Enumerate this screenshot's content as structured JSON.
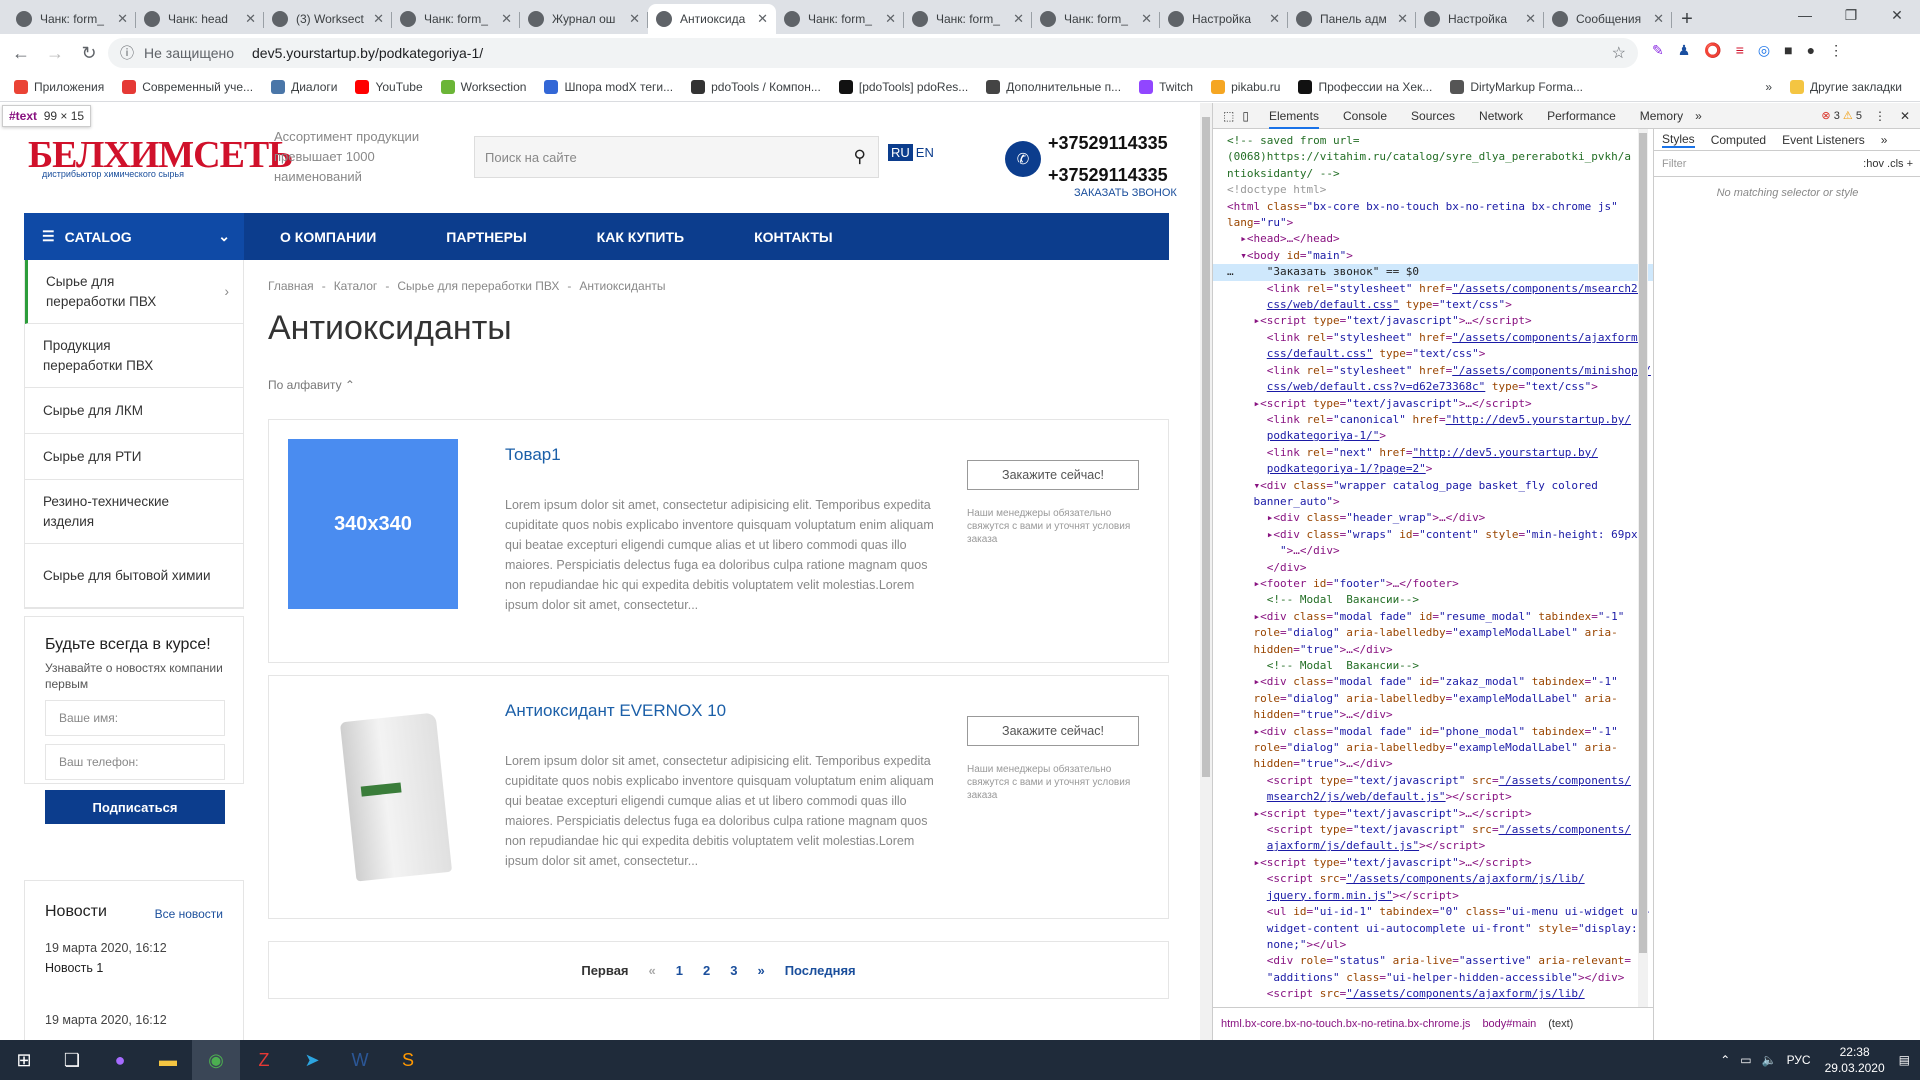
{
  "browser": {
    "tabs": [
      {
        "title": "Чанк: form_",
        "active": false
      },
      {
        "title": "Чанк: head",
        "active": false
      },
      {
        "title": "(3) Worksect",
        "active": false
      },
      {
        "title": "Чанк: form_",
        "active": false
      },
      {
        "title": "Журнал ош",
        "active": false
      },
      {
        "title": "Антиоксида",
        "active": true
      },
      {
        "title": "Чанк: form_",
        "active": false
      },
      {
        "title": "Чанк: form_",
        "active": false
      },
      {
        "title": "Чанк: form_",
        "active": false
      },
      {
        "title": "Настройка",
        "active": false
      },
      {
        "title": "Панель адм",
        "active": false
      },
      {
        "title": "Настройка",
        "active": false
      },
      {
        "title": "Сообщения",
        "active": false
      }
    ],
    "security": "Не защищено",
    "url": "dev5.yourstartup.by/podkategoriya-1/",
    "bookmarks": [
      "Приложения",
      "Современный уче...",
      "Диалоги",
      "YouTube",
      "Worksection",
      "Шпора modX теги...",
      "pdoTools / Компон...",
      "[pdoTools] pdoRes...",
      "Дополнительные п...",
      "Twitch",
      "pikabu.ru",
      "Профессии на Хек...",
      "DirtyMarkup Forma..."
    ],
    "other_bookmarks": "Другие закладки"
  },
  "site": {
    "tooltip_name": "#text",
    "tooltip_size": "99 × 15",
    "logo": "БЕЛХИМСЕТЬ",
    "logo_sub": "дистрибьютор химического сырья",
    "tagline": "Ассортимент продукции превышает 1000 наименований",
    "search_placeholder": "Поиск на сайте",
    "lang_ru": "RU",
    "lang_en": "EN",
    "phone1": "+37529114335",
    "phone2": "+37529114335",
    "callback": "ЗАКАЗАТЬ ЗВОНОК",
    "catalog": "CATALOG",
    "nav": [
      "О КОМПАНИИ",
      "ПАРТНЕРЫ",
      "КАК КУПИТЬ",
      "КОНТАКТЫ"
    ],
    "sidebar": [
      "Сырье для переработки ПВХ",
      "Продукция переработки ПВХ",
      "Сырье для ЛКМ",
      "Сырье для РТИ",
      "Резино-технические изделия",
      "Сырье для бытовой химии"
    ],
    "subscribe": {
      "title": "Будьте всегда в курсе!",
      "text": "Узнавайте о новостях компании первым",
      "name_ph": "Ваше имя:",
      "phone_ph": "Ваш телефон:",
      "button": "Подписаться"
    },
    "news": {
      "title": "Новости",
      "all": "Все новости",
      "item1_date": "19 марта 2020, 16:12",
      "item1_title": "Новость 1",
      "item2_date": "19 марта 2020, 16:12"
    },
    "breadcrumb": [
      "Главная",
      "Каталог",
      "Сырье для переработки ПВХ",
      "Антиоксиданты"
    ],
    "h1": "Антиоксиданты",
    "sort": "По алфавиту ⌃",
    "products": [
      {
        "name": "Товар1",
        "image_text": "340x340",
        "desc": "Lorem ipsum dolor sit amet, consectetur adipisicing elit. Temporibus expedita cupiditate quos nobis explicabo inventore quisquam voluptatum enim aliquam qui beatae excepturi eligendi cumque alias et ut libero commodi quas illo maiores. Perspiciatis delectus fuga ea doloribus culpa ratione magnam quos non repudiandae hic qui expedita debitis voluptatem velit molestias.Lorem ipsum dolor sit amet, consectetur...",
        "order": "Закажите сейчас!",
        "note": "Наши менеджеры обязательно свяжутся с вами и уточнят условия заказа"
      },
      {
        "name": "Антиоксидант EVERNOX 10",
        "image_text": "",
        "desc": "Lorem ipsum dolor sit amet, consectetur adipisicing elit. Temporibus expedita cupiditate quos nobis explicabo inventore quisquam voluptatum enim aliquam qui beatae excepturi eligendi cumque alias et ut libero commodi quas illo maiores. Perspiciatis delectus fuga ea doloribus culpa ratione magnam quos non repudiandae hic qui expedita debitis voluptatem velit molestias.Lorem ipsum dolor sit amet, consectetur...",
        "order": "Закажите сейчас!",
        "note": "Наши менеджеры обязательно свяжутся с вами и уточнят условия заказа"
      }
    ],
    "pager": {
      "first": "Первая",
      "prev": "«",
      "pages": [
        "1",
        "2",
        "3"
      ],
      "next": "»",
      "last": "Последняя"
    }
  },
  "devtools": {
    "tabs": [
      "Elements",
      "Console",
      "Sources",
      "Network",
      "Performance",
      "Memory"
    ],
    "errors": "3",
    "warnings": "5",
    "styles_tabs": [
      "Styles",
      "Computed",
      "Event Listeners"
    ],
    "filter_ph": "Filter",
    "filter_right": ":hov .cls +",
    "no_match": "No matching selector or style",
    "crumbs": [
      "html.bx-core.bx-no-touch.bx-no-retina.bx-chrome.js",
      "body#main",
      "(text)"
    ]
  },
  "taskbar": {
    "lang": "РУС",
    "time": "22:38",
    "date": "29.03.2020"
  }
}
